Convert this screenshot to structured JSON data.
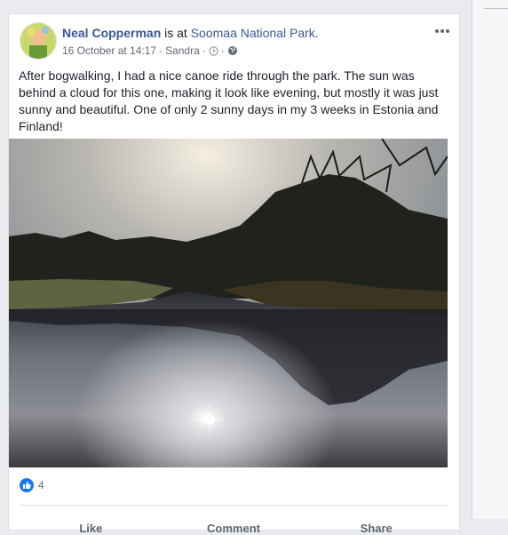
{
  "post": {
    "author": "Neal Copperman",
    "is_at": "is at",
    "place": "Soomaa National Park.",
    "date": "16 October at 14:17",
    "tagged": "Sandra",
    "text": "After bogwalking, I had a nice canoe ride through the park. The sun was behind a cloud for this one, making it look like evening, but mostly it was just sunny and beautiful. One of only 2 sunny days in my 3 weeks in Estonia and Finland!",
    "reaction_count": "4"
  },
  "icons": {
    "audience": "globe-icon",
    "edit": "clock-icon",
    "options": "more-dots-icon",
    "reaction": "like-icon"
  },
  "actions": [
    {
      "label": "Like"
    },
    {
      "label": "Comment"
    },
    {
      "label": "Share"
    }
  ],
  "colors": {
    "link": "#385898",
    "like_blue": "#1877f2",
    "background": "#e9ebee"
  }
}
